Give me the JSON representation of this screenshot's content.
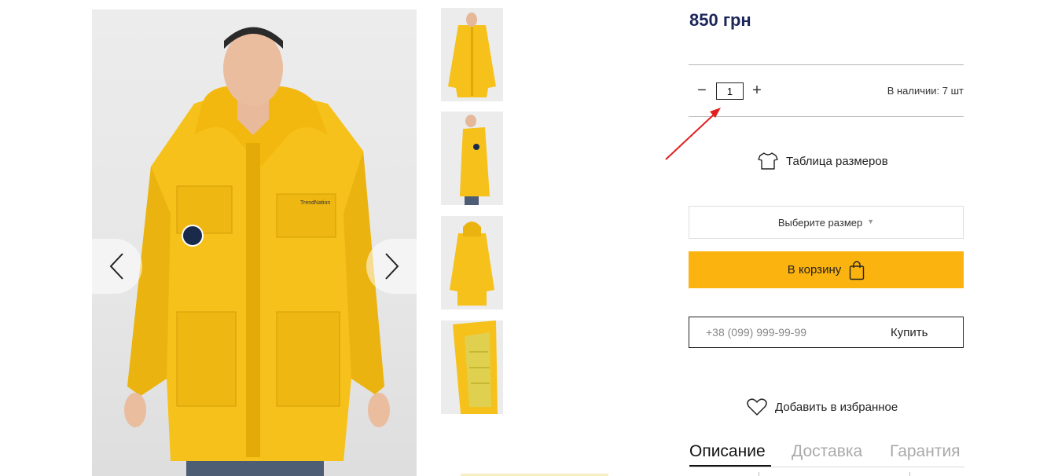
{
  "product": {
    "price": "850 грн",
    "quantity": "1",
    "quantity_minus": "−",
    "quantity_plus": "+",
    "stock": "В наличии: 7 шт",
    "size_table_label": "Таблица размеров",
    "size_select_label": "Выберите размер",
    "add_to_cart_label": "В корзину",
    "phone_placeholder": "+38 (099) 999-99-99",
    "quick_buy_label": "Купить",
    "favorites_label": "Добавить в избранное"
  },
  "tabs": [
    {
      "label": "Описание",
      "active": true
    },
    {
      "label": "Доставка",
      "active": false
    },
    {
      "label": "Гарантия",
      "active": false
    }
  ],
  "gallery": {
    "main_image": "yellow-parka-front-photo",
    "thumbnails": [
      "front-view",
      "side-view",
      "back-view",
      "open-inside-view"
    ],
    "prev_icon": "chevron-left-icon",
    "next_icon": "chevron-right-icon"
  },
  "colors": {
    "price": "#1b2659",
    "cart_button": "#fbb30f",
    "jacket": "#f6c11a",
    "annotation_arrow": "#e02020"
  },
  "icons": {
    "size_table": "t-shirt-icon",
    "cart": "shopping-bag-icon",
    "favorites": "heart-icon",
    "select_caret": "chevron-down-icon"
  }
}
